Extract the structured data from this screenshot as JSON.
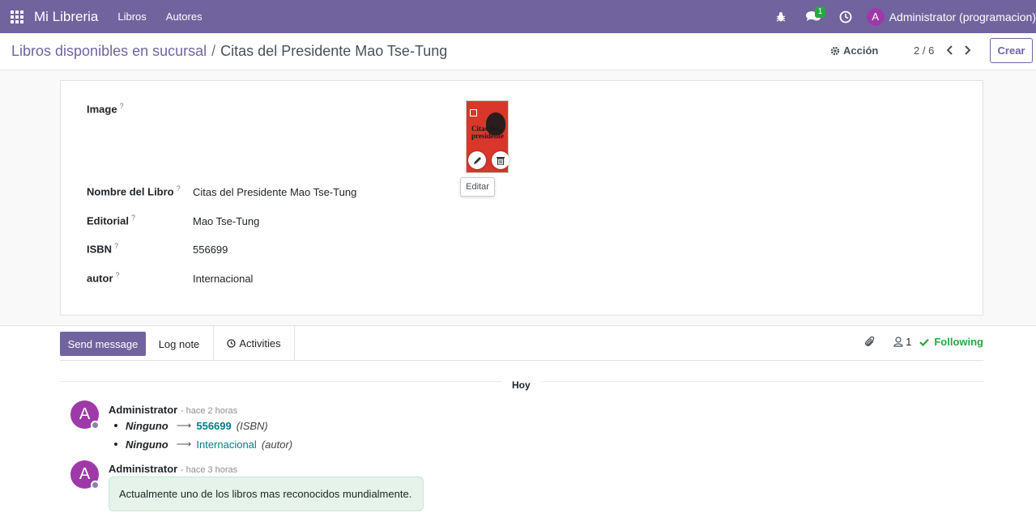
{
  "navbar": {
    "brand": "Mi Libreria",
    "menu": [
      "Libros",
      "Autores"
    ],
    "messages_badge": "1",
    "user_initial": "A",
    "user_name": "Administrator (programacion)"
  },
  "control_panel": {
    "breadcrumb_parent": "Libros disponibles en sucursal",
    "breadcrumb_separator": "/",
    "breadcrumb_current": "Citas del Presidente Mao Tse-Tung",
    "action_label": "Acción",
    "pager": "2 / 6",
    "create_label": "Crear"
  },
  "form": {
    "image_label": "Image",
    "help_mark": "?",
    "fields": [
      {
        "label": "Nombre del Libro",
        "value": "Citas del Presidente Mao Tse-Tung"
      },
      {
        "label": "Editorial",
        "value": "Mao Tse-Tung"
      },
      {
        "label": "ISBN",
        "value": "556699"
      },
      {
        "label": "autor",
        "value": "Internacional"
      }
    ],
    "image_edit_tooltip": "Editar",
    "cover_text": "Citas del presidente"
  },
  "chatter": {
    "send_message": "Send message",
    "log_note": "Log note",
    "activities": "Activities",
    "followers_count": "1",
    "following": "Following",
    "date_separator": "Hoy",
    "messages": [
      {
        "author": "Administrator",
        "when": "- hace 2 horas",
        "avatar_initial": "A",
        "tracking": [
          {
            "old": "Ninguno",
            "new": "556699",
            "field": "(ISBN)"
          },
          {
            "old": "Ninguno",
            "new": "Internacional",
            "field": "(autor)"
          }
        ]
      },
      {
        "author": "Administrator",
        "when": "- hace 3 horas",
        "avatar_initial": "A",
        "body": "Actualmente uno de los libros mas reconocidos mundialmente."
      }
    ]
  },
  "colors": {
    "brand": "#71639e",
    "success": "#28a745",
    "link": "#017e84",
    "avatar": "#9e3aa8"
  }
}
